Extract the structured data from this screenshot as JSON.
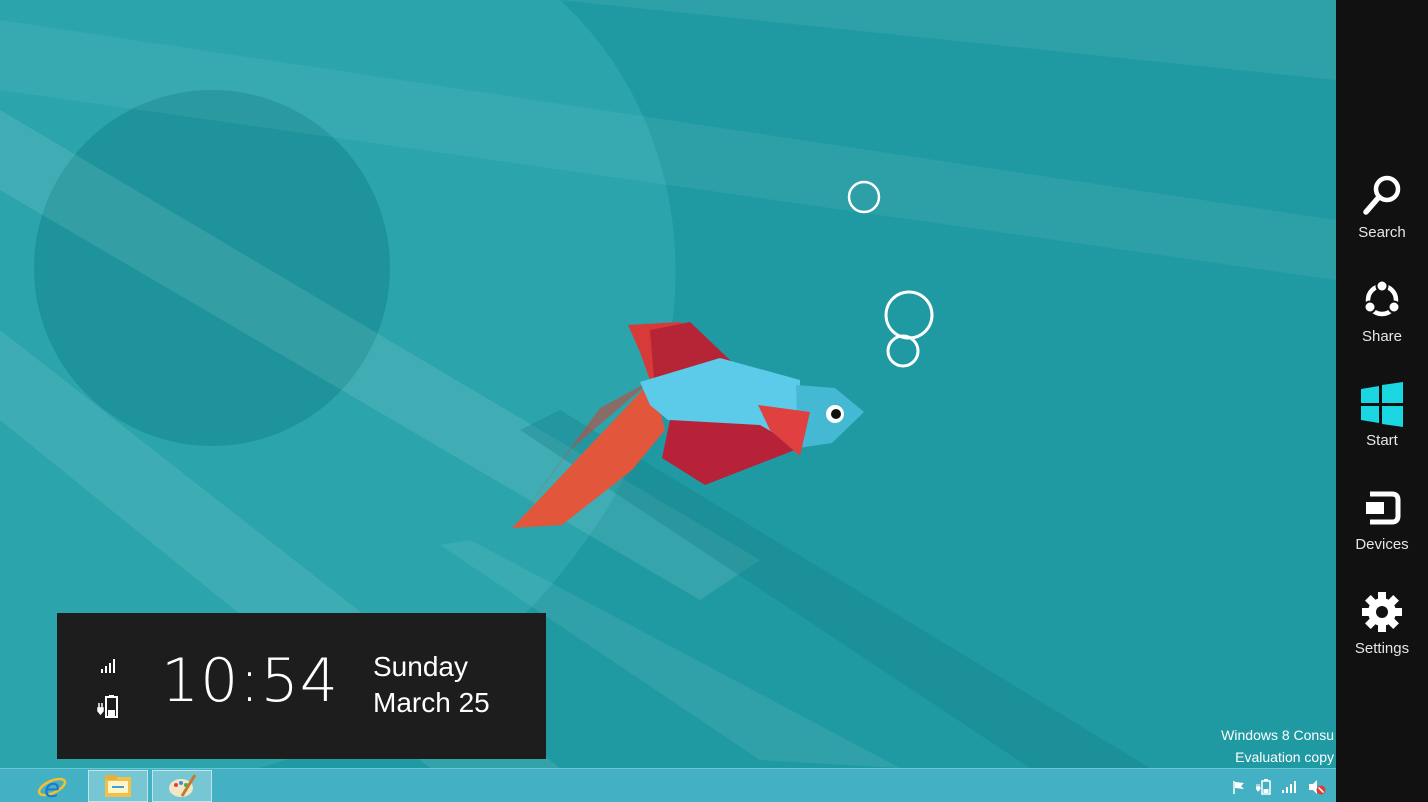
{
  "lock_overlay": {
    "time": "10:54",
    "day": "Sunday",
    "date": "March 25"
  },
  "watermark": {
    "line1": "Windows 8 Consu",
    "line2": "Evaluation copy"
  },
  "charms": [
    {
      "label": "Search",
      "icon": "search-icon"
    },
    {
      "label": "Share",
      "icon": "share-icon"
    },
    {
      "label": "Start",
      "icon": "windows-logo-icon"
    },
    {
      "label": "Devices",
      "icon": "devices-icon"
    },
    {
      "label": "Settings",
      "icon": "gear-icon"
    }
  ],
  "taskbar": {
    "items": [
      {
        "icon": "internet-explorer-icon"
      },
      {
        "icon": "file-explorer-icon"
      },
      {
        "icon": "paint-icon"
      }
    ],
    "tray_icons": [
      "flag-icon",
      "battery-icon",
      "signal-icon",
      "volume-muted-icon"
    ]
  },
  "colors": {
    "wallpaper": "#1f9aa2",
    "charms_bar": "#111111",
    "taskbar": "#43b0c3",
    "start_accent": "#1ad6e0"
  }
}
